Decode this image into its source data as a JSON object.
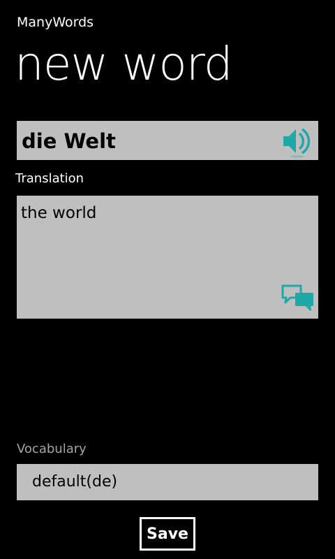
{
  "app": {
    "name": "ManyWords",
    "page_title": "new word"
  },
  "word": {
    "value": "die Welt",
    "speak_icon": "speaker-icon"
  },
  "translation": {
    "label": "Translation",
    "value": "the world",
    "translate_icon": "chat-bubbles-icon"
  },
  "vocabulary": {
    "label": "Vocabulary",
    "selected": "default(de)"
  },
  "actions": {
    "save_label": "Save"
  },
  "colors": {
    "background": "#000000",
    "field": "#bfbfbf",
    "accent": "#1fa8a8",
    "muted_label": "#a6a6a6"
  }
}
